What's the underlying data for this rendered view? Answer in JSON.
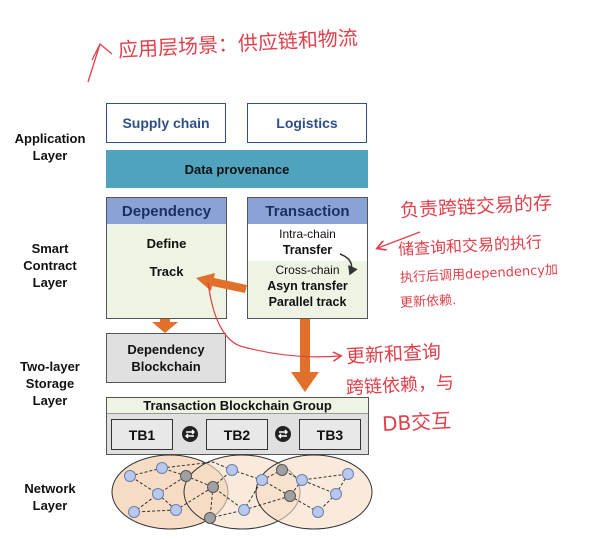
{
  "layers": {
    "application": "Application\nLayer",
    "smart_contract": "Smart\nContract\nLayer",
    "storage": "Two-layer\nStorage\nLayer",
    "network": "Network\nLayer"
  },
  "application": {
    "supply_chain": "Supply chain",
    "logistics": "Logistics",
    "data_provenance": "Data provenance"
  },
  "dependency_box": {
    "title": "Dependency",
    "define": "Define",
    "track": "Track"
  },
  "transaction_box": {
    "title": "Transaction",
    "intra_chain": "Intra-chain",
    "transfer": "Transfer",
    "cross_chain": "Cross-chain",
    "asyn_transfer": "Asyn transfer",
    "parallel_track": "Parallel track"
  },
  "storage": {
    "dependency_blockchain": "Dependency\nBlockchain",
    "group_title": "Transaction Blockchain Group",
    "tb1": "TB1",
    "tb2": "TB2",
    "tb3": "TB3"
  },
  "annotations": {
    "top_note": "应用层场景：供应链和物流",
    "right_note_1": "负责跨链交易的存",
    "right_note_2": "储查询和交易的执行",
    "right_note_3": "执行后调用dependency加",
    "right_note_4": "更新依赖.",
    "mid_note_1": "更新和查询",
    "mid_note_2": "跨链依赖，与",
    "mid_note_3": "DB交互"
  },
  "colors": {
    "navy": "#2f4f86",
    "teal": "#4fa3bd",
    "header_blue": "#8aa3d6",
    "gray_fill": "#e0e0e0",
    "green_fill": "#eef4e4",
    "orange": "#e0702a",
    "annotation_red": "#e0404a"
  }
}
